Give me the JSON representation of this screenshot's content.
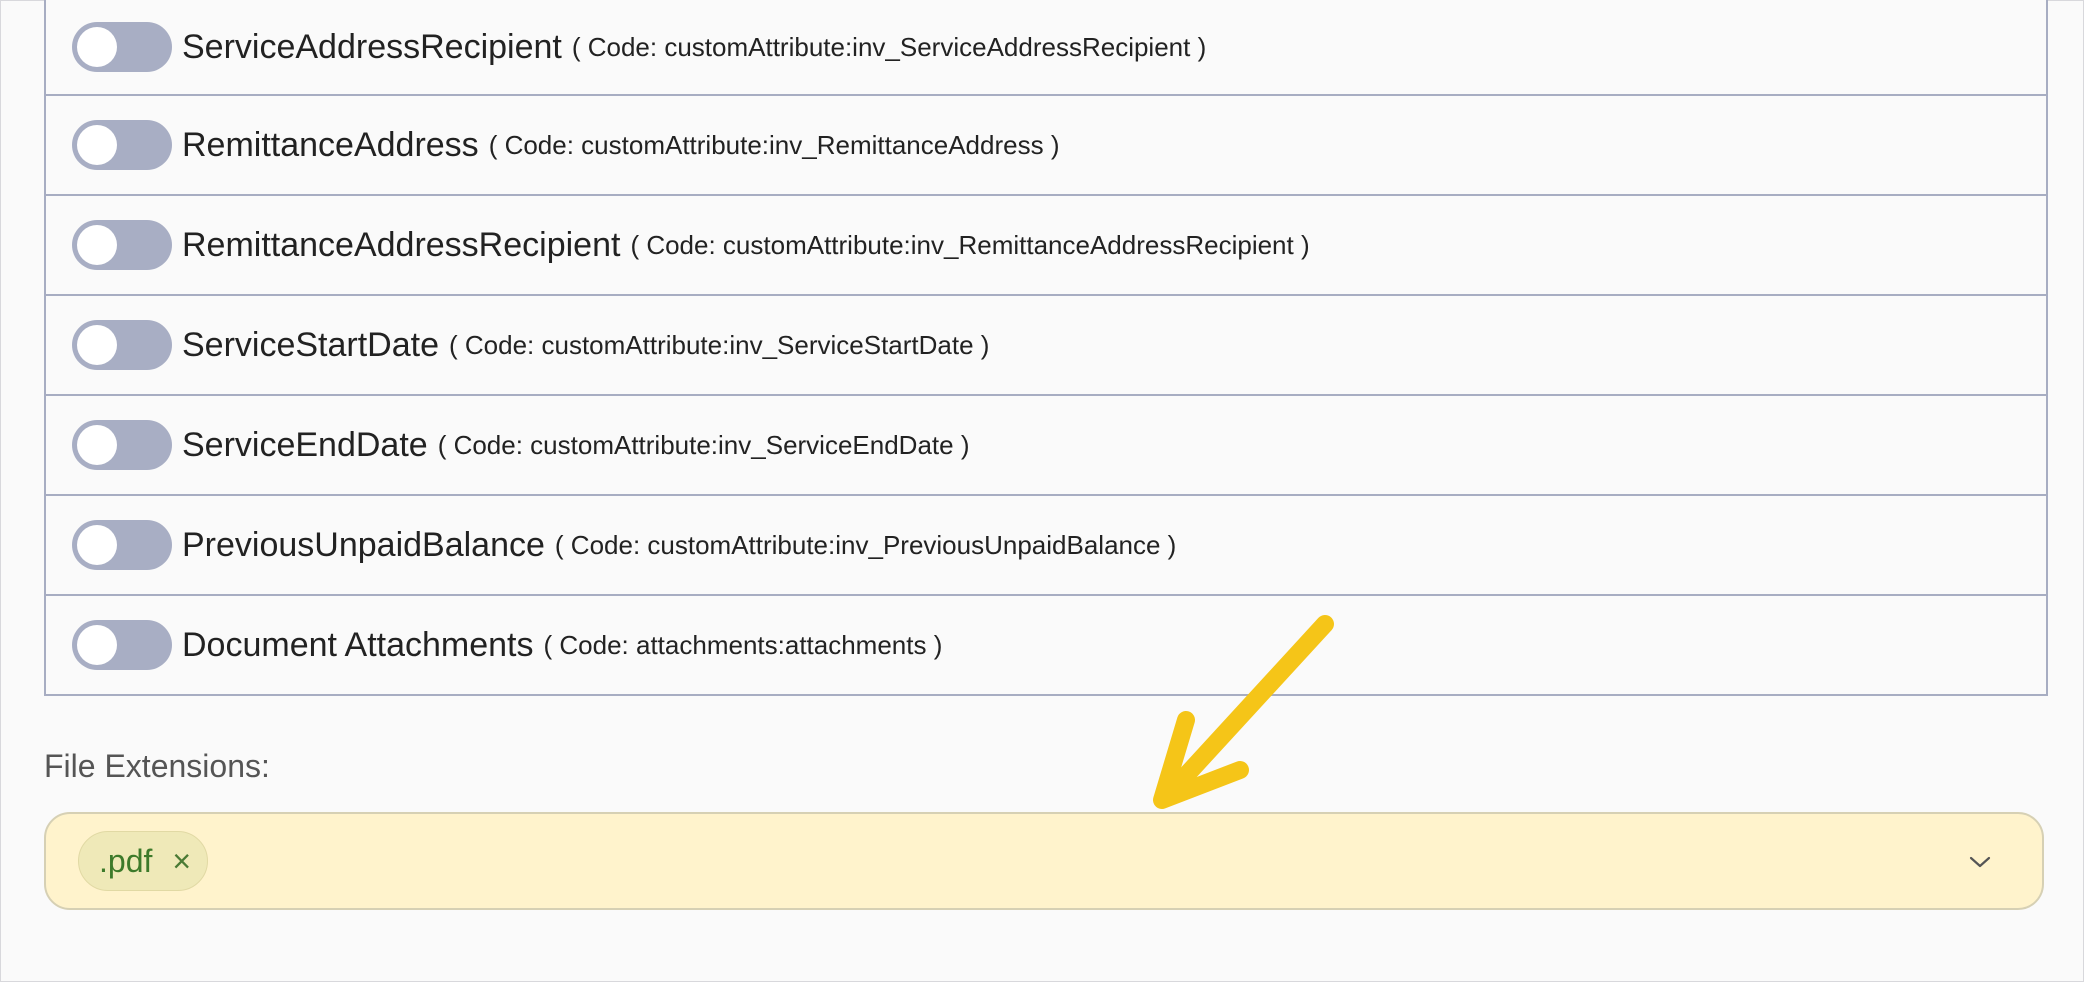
{
  "attributes": [
    {
      "label": "ServiceAddressRecipient",
      "code": "( Code: customAttribute:inv_ServiceAddressRecipient )"
    },
    {
      "label": "RemittanceAddress",
      "code": "( Code: customAttribute:inv_RemittanceAddress )"
    },
    {
      "label": "RemittanceAddressRecipient",
      "code": "( Code: customAttribute:inv_RemittanceAddressRecipient )"
    },
    {
      "label": "ServiceStartDate",
      "code": "( Code: customAttribute:inv_ServiceStartDate )"
    },
    {
      "label": "ServiceEndDate",
      "code": "( Code: customAttribute:inv_ServiceEndDate )"
    },
    {
      "label": "PreviousUnpaidBalance",
      "code": "( Code: customAttribute:inv_PreviousUnpaidBalance )"
    },
    {
      "label": "Document Attachments",
      "code": "( Code: attachments:attachments )"
    }
  ],
  "file_extensions": {
    "label": "File Extensions:",
    "selected": [
      ".pdf"
    ],
    "remove_glyph": "×"
  },
  "colors": {
    "toggle_off": "#a8aec4",
    "select_bg": "#fff3cc",
    "chip_text": "#3d7a2a",
    "annotation_arrow": "#f5c518"
  },
  "icons": [
    "toggle-switch",
    "chip-remove-icon",
    "chevron-down-icon",
    "annotation-arrow-icon"
  ]
}
